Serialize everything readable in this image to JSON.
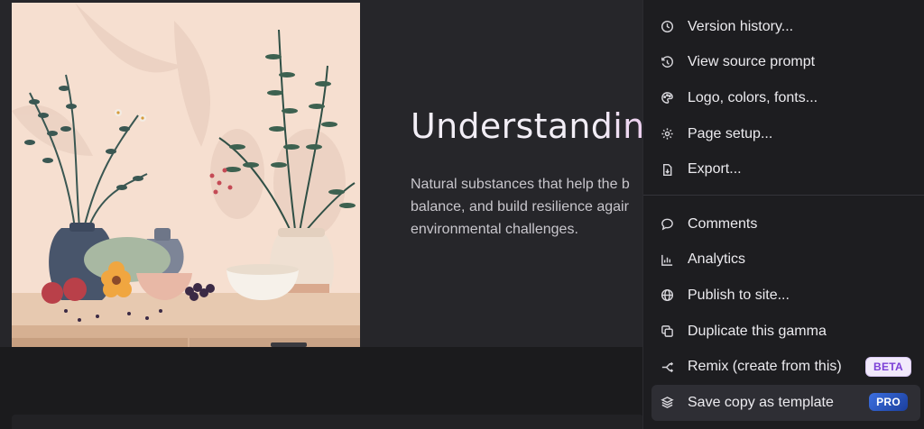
{
  "slide": {
    "title": "Understanding",
    "body": "Natural substances that help the b\nbalance, and build resilience agair\nenvironmental challenges."
  },
  "menu": {
    "items_top": [
      {
        "label": "Version history...",
        "icon": "clock-icon"
      },
      {
        "label": "View source prompt",
        "icon": "history-icon"
      },
      {
        "label": "Logo, colors, fonts...",
        "icon": "palette-icon"
      },
      {
        "label": "Page setup...",
        "icon": "gear-icon"
      },
      {
        "label": "Export...",
        "icon": "export-file-icon"
      }
    ],
    "items_bottom": [
      {
        "label": "Comments",
        "icon": "comment-icon"
      },
      {
        "label": "Analytics",
        "icon": "chart-icon"
      },
      {
        "label": "Publish to site...",
        "icon": "globe-icon"
      },
      {
        "label": "Duplicate this gamma",
        "icon": "duplicate-icon"
      },
      {
        "label": "Remix (create from this)",
        "icon": "remix-icon",
        "badge": "BETA"
      },
      {
        "label": "Save copy as template",
        "icon": "layers-icon",
        "badge": "PRO"
      }
    ]
  }
}
